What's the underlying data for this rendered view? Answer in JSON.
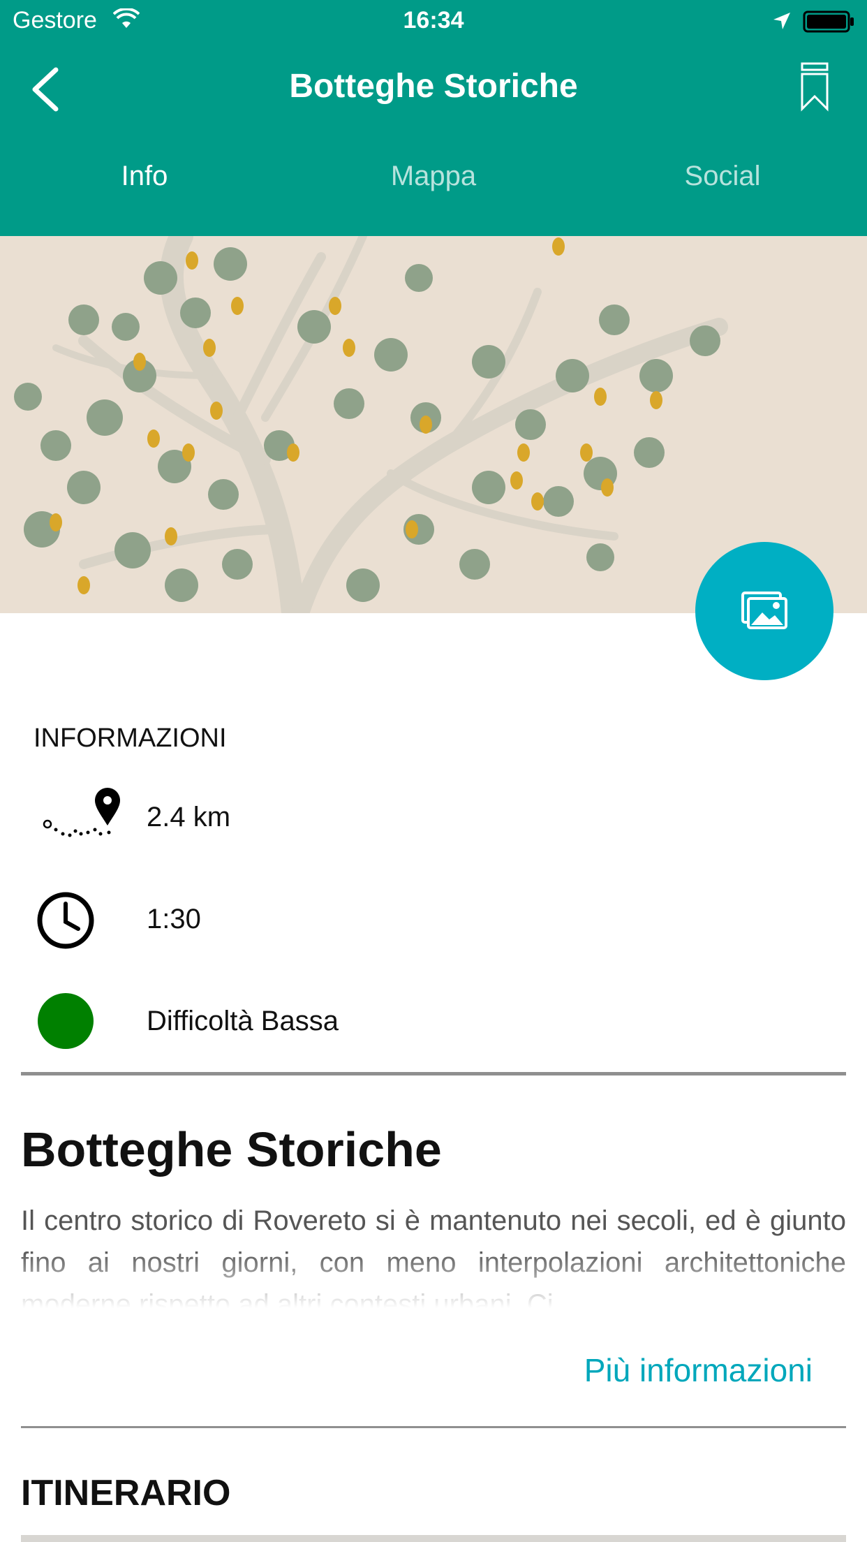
{
  "status_bar": {
    "carrier": "Gestore",
    "time": "16:34"
  },
  "header": {
    "title": "Botteghe Storiche",
    "tabs": [
      {
        "label": "Info",
        "active": true
      },
      {
        "label": "Mappa",
        "active": false
      },
      {
        "label": "Social",
        "active": false
      }
    ],
    "color": "#009b88"
  },
  "hero": {
    "fab_color": "#00afc3"
  },
  "info": {
    "heading": "INFORMAZIONI",
    "distance": "2.4 km",
    "duration": "1:30",
    "difficulty": "Difficoltà Bassa",
    "difficulty_color": "#008000"
  },
  "detail": {
    "title": "Botteghe Storiche",
    "description": "Il centro storico di Rovereto si è mantenuto nei secoli, ed è giunto fino ai nostri giorni, con meno interpolazioni architettoniche moderne rispetto ad altri contesti urbani. Ci",
    "more_link": "Più informazioni"
  },
  "itinerary": {
    "heading": "ITINERARIO"
  }
}
